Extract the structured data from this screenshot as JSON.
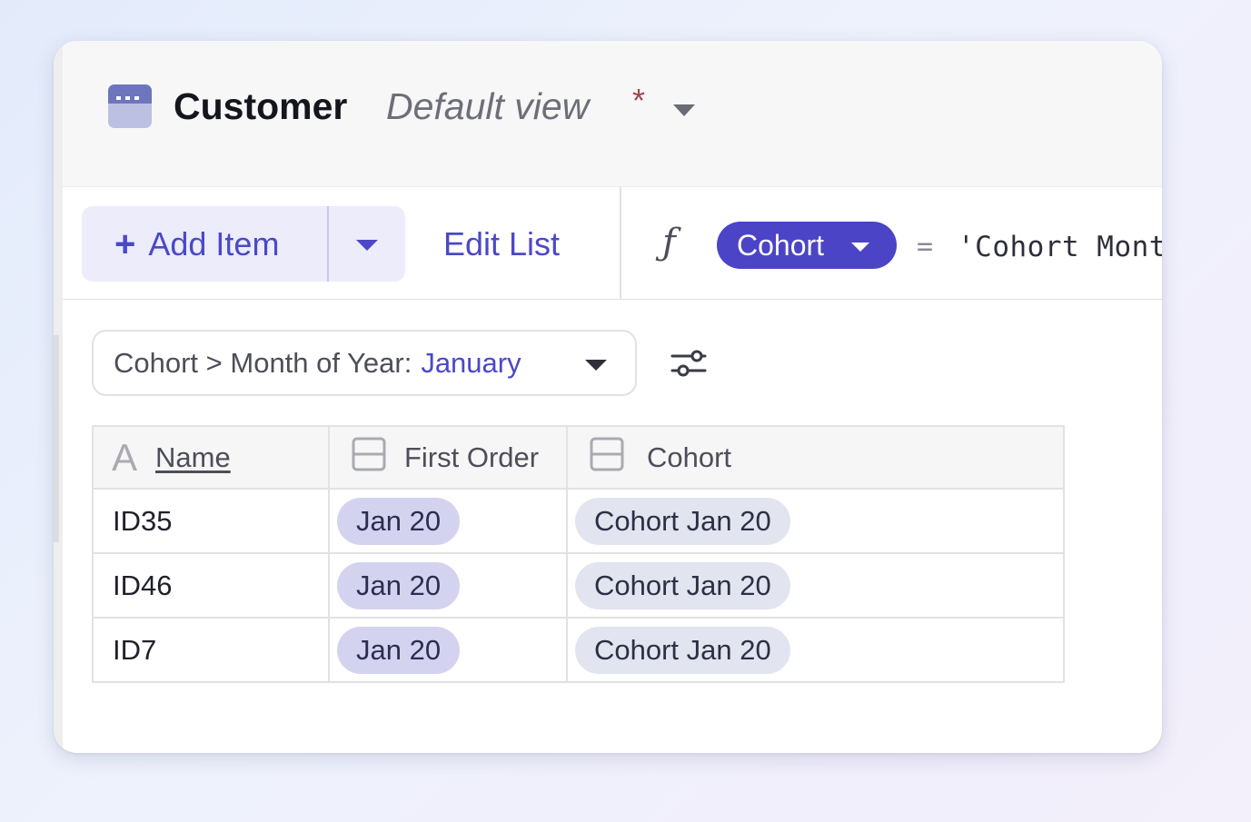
{
  "header": {
    "title": "Customer",
    "view_name": "Default view",
    "modified_marker": "*",
    "icon": "table-icon"
  },
  "toolbar": {
    "add_item_label": "Add Item",
    "add_item_icon": "plus-icon",
    "edit_list_label": "Edit List",
    "formula_icon": "function-icon",
    "field_chip_label": "Cohort",
    "operator": "=",
    "formula_text": "'Cohort Mont"
  },
  "filter": {
    "label": "Cohort > Month of Year:",
    "value": "January",
    "settings_icon": "sliders-icon"
  },
  "table": {
    "columns": [
      {
        "label": "Name",
        "icon": "text-type-icon"
      },
      {
        "label": "First Order",
        "icon": "link-field-icon"
      },
      {
        "label": "Cohort",
        "icon": "link-field-icon"
      }
    ],
    "rows": [
      {
        "name": "ID35",
        "first_order": "Jan 20",
        "cohort": "Cohort Jan 20"
      },
      {
        "name": "ID46",
        "first_order": "Jan 20",
        "cohort": "Cohort Jan 20"
      },
      {
        "name": "ID7",
        "first_order": "Jan 20",
        "cohort": "Cohort Jan 20"
      }
    ]
  },
  "colors": {
    "accent": "#4b48c8",
    "pill": "#4b44c6",
    "first_order_chip": "#d4d3ef",
    "cohort_chip": "#e2e5ef"
  }
}
